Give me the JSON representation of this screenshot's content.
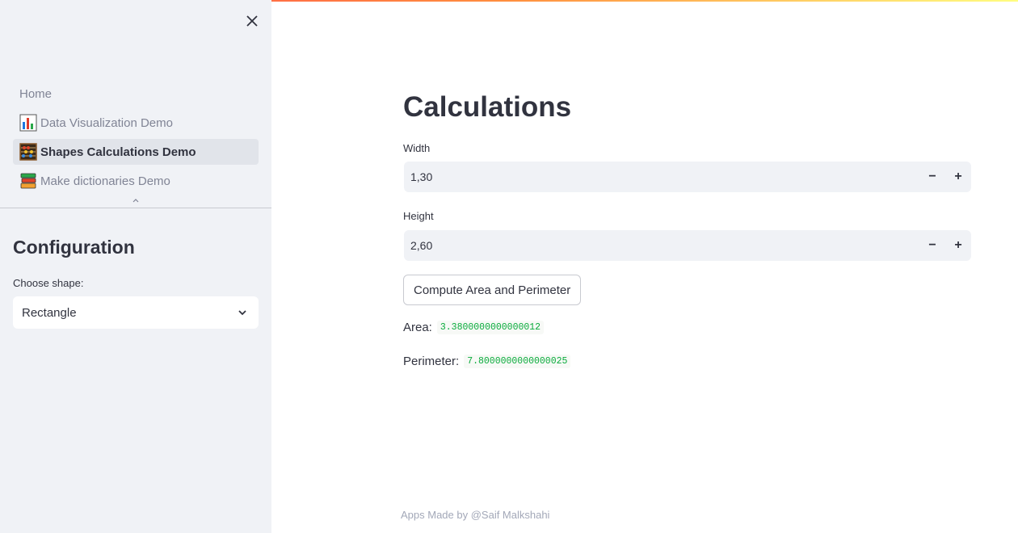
{
  "sidebar": {
    "nav_items": [
      {
        "label": "Home",
        "icon": "none"
      },
      {
        "label": "Data Visualization Demo",
        "icon": "bar-chart-icon"
      },
      {
        "label": "Shapes Calculations Demo",
        "icon": "abacus-icon",
        "active": true
      },
      {
        "label": "Make dictionaries Demo",
        "icon": "books-icon"
      }
    ],
    "config_title": "Configuration",
    "shape_label": "Choose shape:",
    "shape_value": "Rectangle"
  },
  "main": {
    "title": "Calculations",
    "width_label": "Width",
    "width_value": "1,30",
    "height_label": "Height",
    "height_value": "2,60",
    "minus_symbol": "−",
    "plus_symbol": "+",
    "compute_label": "Compute Area and Perimeter",
    "area_label": "Area:",
    "area_value": "3.3800000000000012",
    "perimeter_label": "Perimeter:",
    "perimeter_value": "7.8000000000000025"
  },
  "footer": {
    "text": "Apps Made by @Saif Malkshahi"
  },
  "colors": {
    "accent": "#ff4b4b",
    "sidebar_bg": "#f0f2f6",
    "code_green": "#09ab3b"
  }
}
